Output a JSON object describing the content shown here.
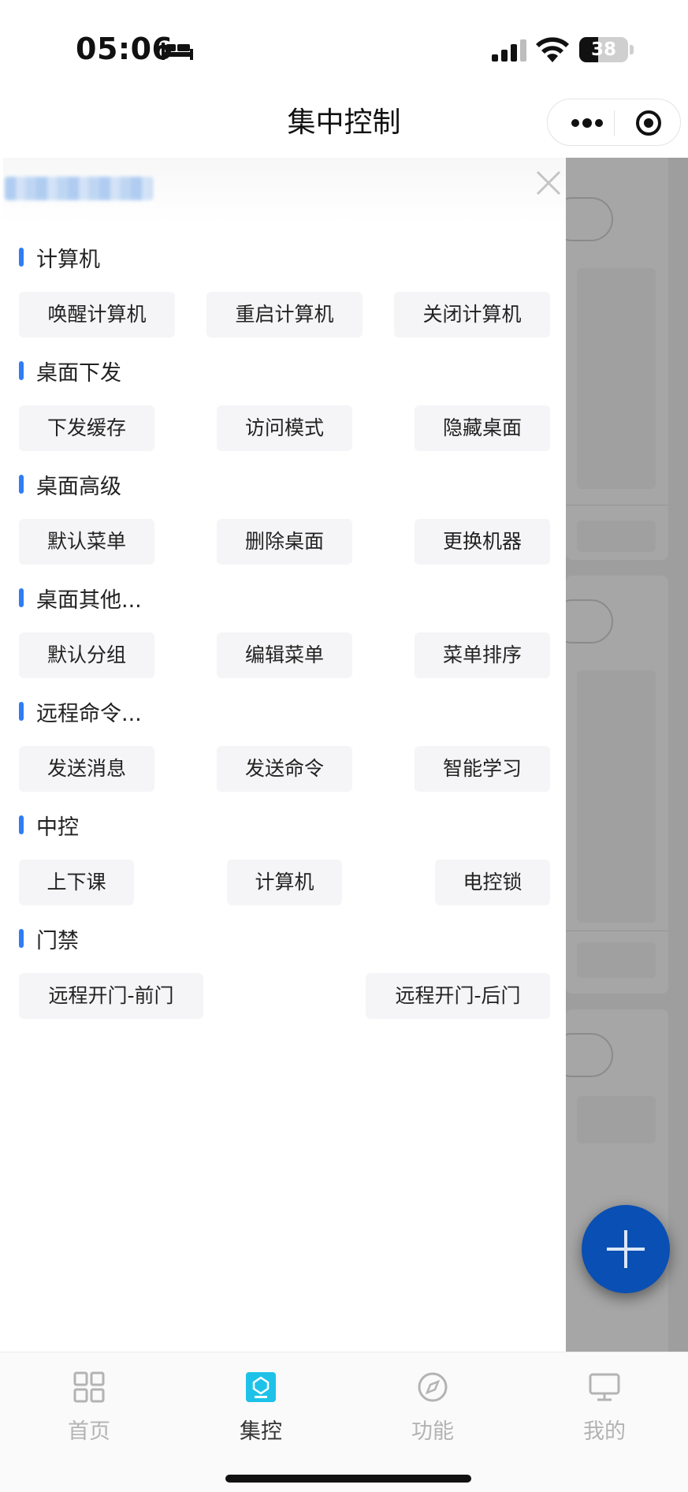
{
  "status_bar": {
    "time": "05:06",
    "battery": "38",
    "battery_level": 0.38,
    "icons": [
      "bed-icon",
      "cellular-signal-icon",
      "wifi-icon",
      "battery-icon"
    ]
  },
  "nav": {
    "title": "集中控制",
    "icons": [
      "more-dots-icon",
      "target-circle-icon"
    ]
  },
  "drawer": {
    "close_icon": "close-icon",
    "sections": [
      {
        "title": "计算机",
        "buttons": [
          "唤醒计算机",
          "重启计算机",
          "关闭计算机"
        ]
      },
      {
        "title": "桌面下发",
        "buttons": [
          "下发缓存",
          "访问模式",
          "隐藏桌面"
        ]
      },
      {
        "title": "桌面高级",
        "buttons": [
          "默认菜单",
          "删除桌面",
          "更换机器"
        ]
      },
      {
        "title": "桌面其他...",
        "buttons": [
          "默认分组",
          "编辑菜单",
          "菜单排序"
        ]
      },
      {
        "title": "远程命令...",
        "buttons": [
          "发送消息",
          "发送命令",
          "智能学习"
        ]
      },
      {
        "title": "中控",
        "buttons": [
          "上下课",
          "计算机",
          "电控锁"
        ]
      },
      {
        "title": "门禁",
        "buttons": [
          "远程开门-前门",
          "远程开门-后门"
        ]
      }
    ]
  },
  "fab": {
    "icon": "plus-icon"
  },
  "tabbar": {
    "tabs": [
      {
        "label": "首页",
        "icon": "grid-icon",
        "active": false
      },
      {
        "label": "集控",
        "icon": "control-center-icon",
        "active": true
      },
      {
        "label": "功能",
        "icon": "compass-icon",
        "active": false
      },
      {
        "label": "我的",
        "icon": "monitor-icon",
        "active": false
      }
    ]
  },
  "colors": {
    "accent": "#2f7cf6",
    "fab": "#0a4fb3",
    "active_tab_icon": "#1ec2e8",
    "button_bg": "#f5f5f7"
  }
}
